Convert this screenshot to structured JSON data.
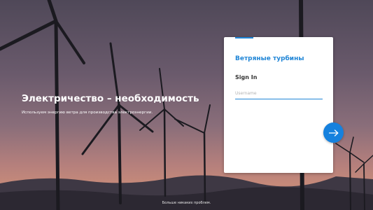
{
  "hero": {
    "title": "Электричество – необходимость",
    "subtitle": "Используем энергию ветра для производства электроэнергии."
  },
  "login": {
    "brand": "Ветряные турбины",
    "heading": "Sign In",
    "username_placeholder": "Username",
    "username_value": "",
    "next_icon": "arrow-right-icon"
  },
  "footer": {
    "text": "Больше никаких проблем."
  },
  "colors": {
    "accent": "#1f85d6",
    "button": "#1581de",
    "sky_top": "#5b5266",
    "sky_bottom": "#c9867a"
  }
}
